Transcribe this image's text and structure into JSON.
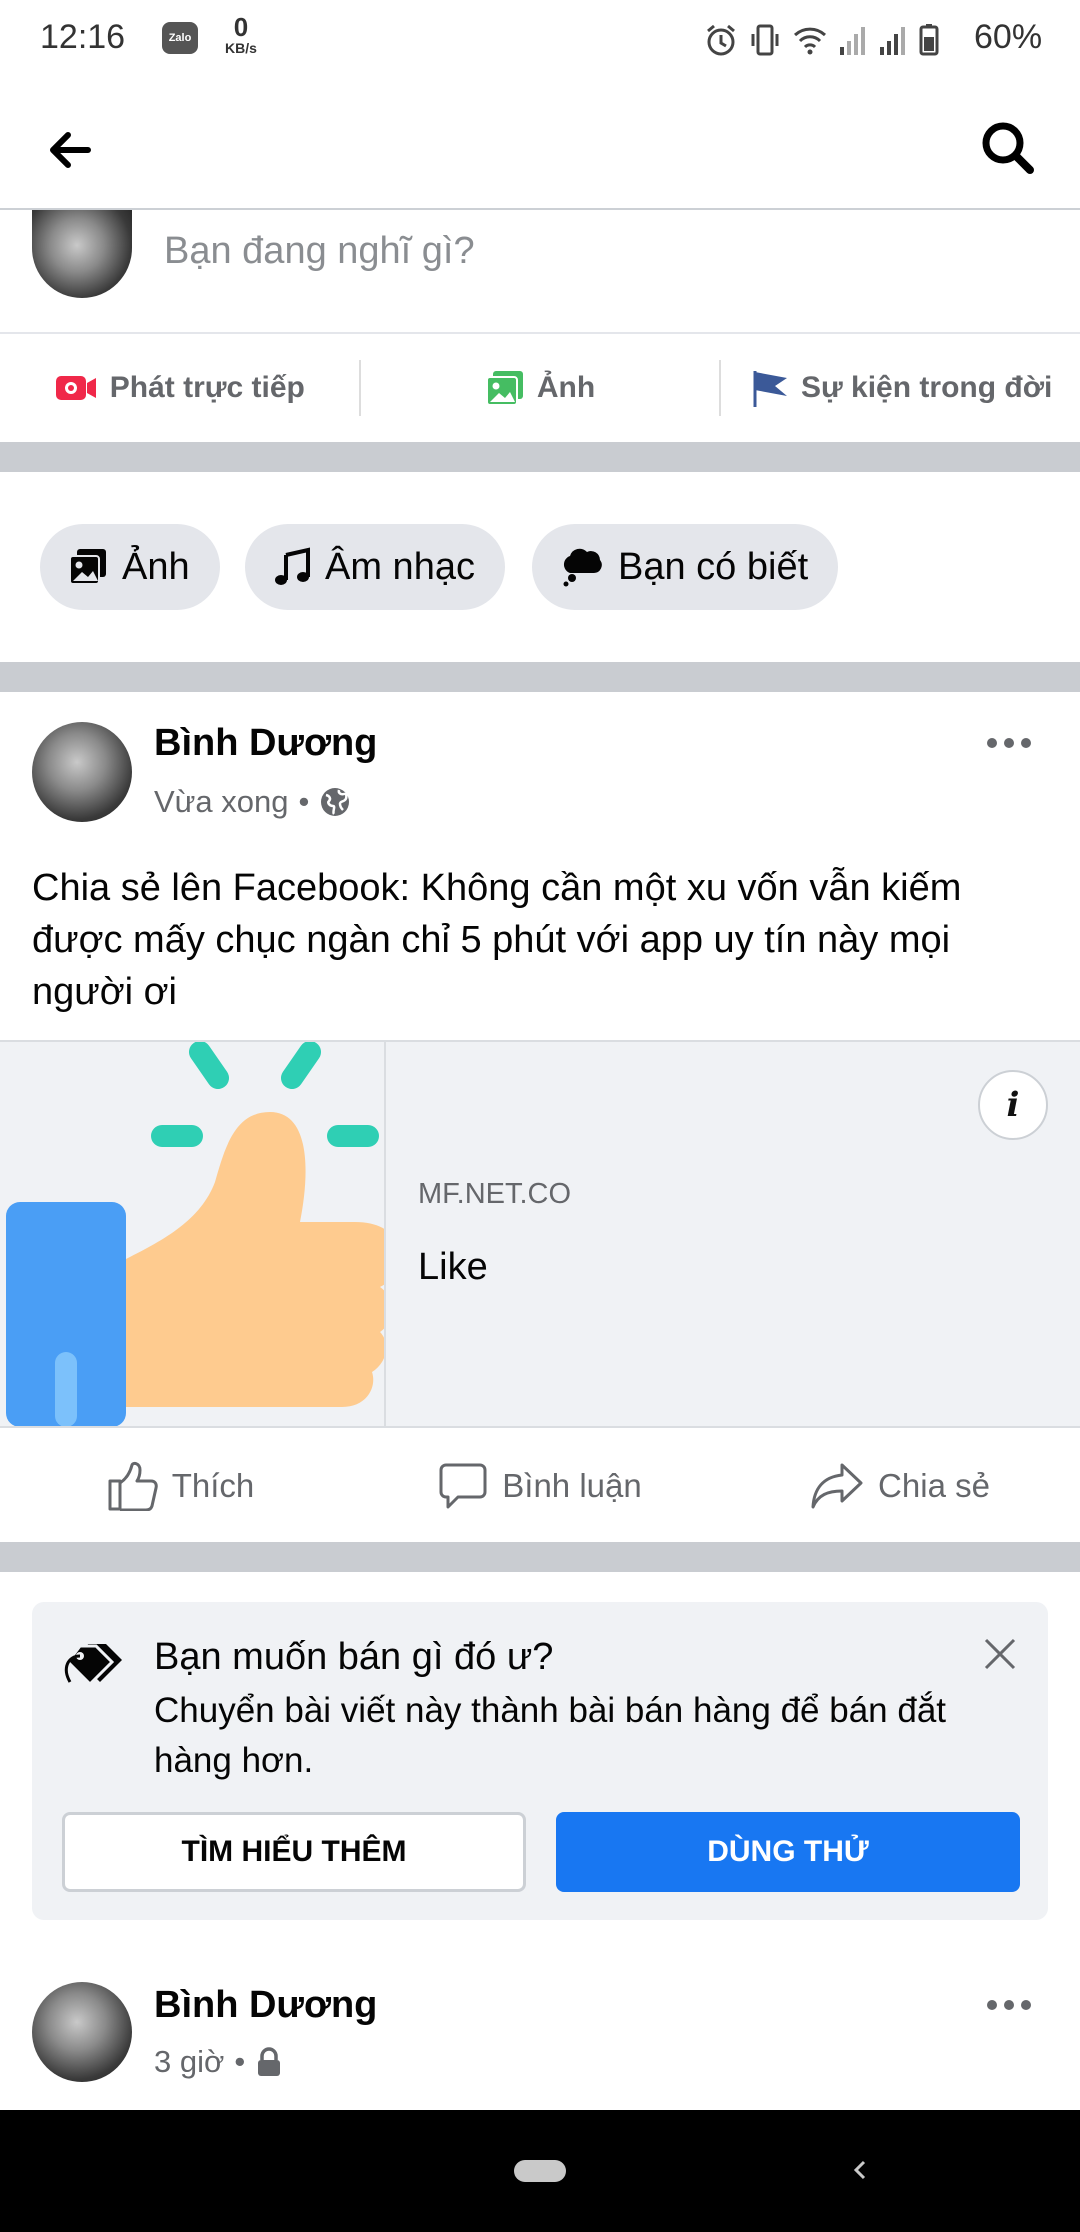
{
  "status_bar": {
    "time": "12:16",
    "zalo": "Zalo",
    "net_speed_value": "0",
    "net_speed_unit": "KB/s",
    "battery": "60%"
  },
  "nav": {
    "back_icon": "arrow-left-icon",
    "search_icon": "search-icon"
  },
  "composer": {
    "placeholder": "Bạn đang nghĩ gì?",
    "actions": [
      {
        "label": "Phát trực tiếp",
        "icon": "live-video-icon",
        "color": "#f02849"
      },
      {
        "label": "Ảnh",
        "icon": "photo-icon",
        "color": "#45bd62"
      },
      {
        "label": "Sự kiện trong đời",
        "icon": "flag-icon",
        "color": "#3b5998"
      }
    ]
  },
  "chips": [
    {
      "label": "Ảnh",
      "icon": "photo-icon"
    },
    {
      "label": "Âm nhạc",
      "icon": "music-note-icon"
    },
    {
      "label": "Bạn có biết",
      "icon": "thought-bubble-icon"
    }
  ],
  "post": {
    "author": "Bình Dương",
    "time": "Vừa xong",
    "dot": "•",
    "privacy_icon": "globe-icon",
    "text": "Chia sẻ lên Facebook: Không cần một xu vốn vẫn kiếm được mấy chục ngàn chỉ 5 phút với app uy tín này mọi người ơi",
    "link": {
      "domain": "MF.NET.CO",
      "title": "Like",
      "info": "i"
    },
    "actions": [
      {
        "label": "Thích",
        "icon": "thumbs-up-icon"
      },
      {
        "label": "Bình luận",
        "icon": "comment-icon"
      },
      {
        "label": "Chia sẻ",
        "icon": "share-icon"
      }
    ]
  },
  "promo": {
    "title": "Bạn muốn bán gì đó ư?",
    "description": "Chuyển bài viết này thành bài bán hàng để bán đắt hàng hơn.",
    "learn_more": "TÌM HIỂU THÊM",
    "try": "DÙNG THỬ"
  },
  "post2": {
    "author": "Bình Dương",
    "time": "3 giờ",
    "dot": "•",
    "privacy_icon": "lock-icon"
  },
  "colors": {
    "accent": "#1877f2",
    "separator": "#c9ccd1",
    "secondary_text": "#65676b"
  }
}
